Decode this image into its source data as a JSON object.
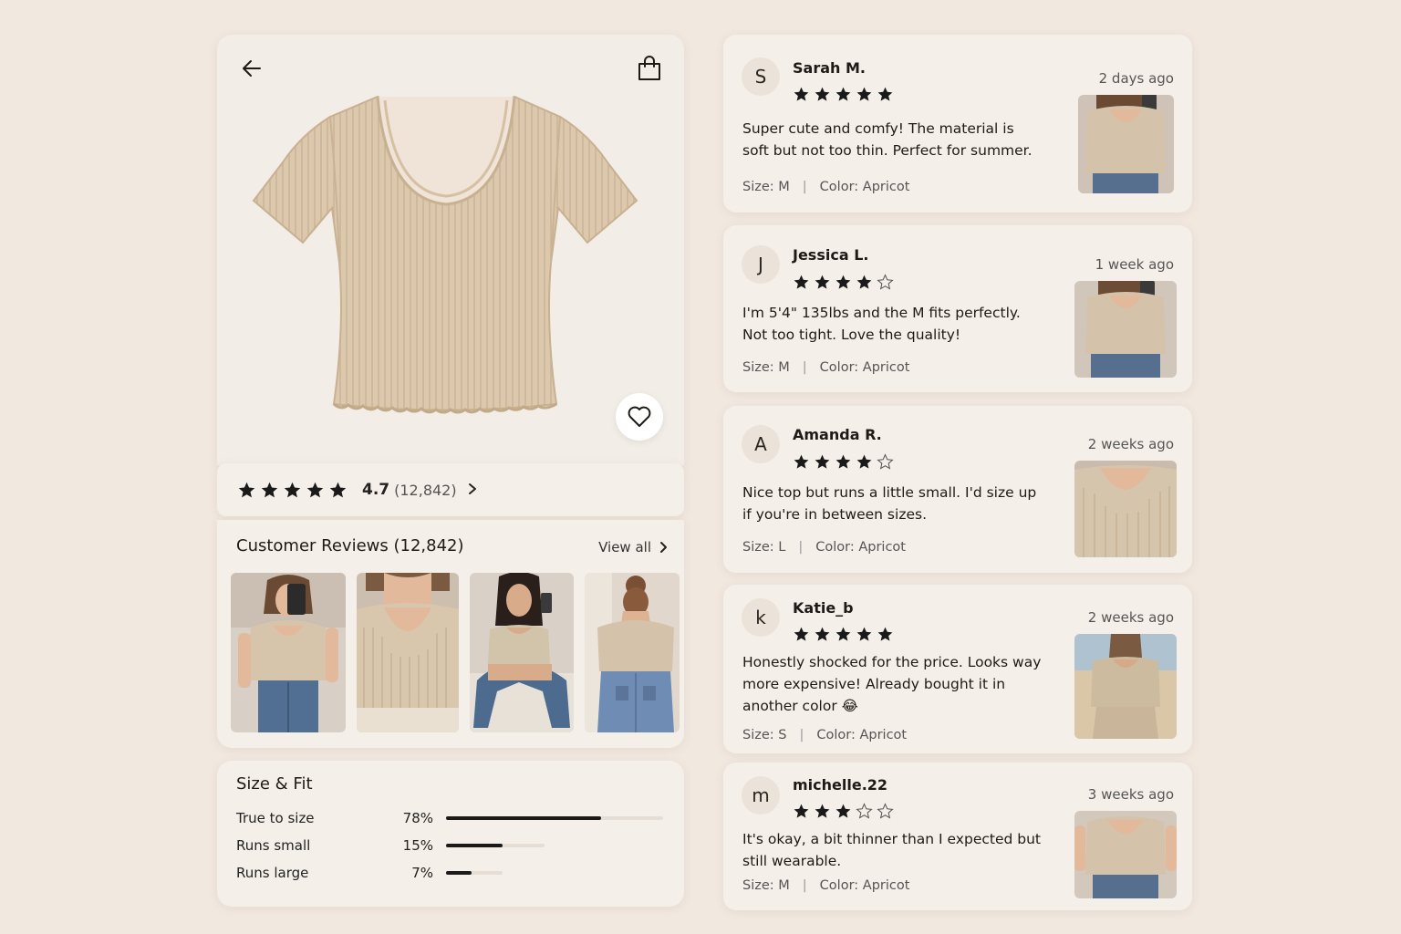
{
  "product": {
    "rating_value": "4.7",
    "rating_count": "(12,842)",
    "rating_stars": 5
  },
  "customer_reviews": {
    "title": "Customer Reviews (12,842)",
    "view_all": "View all"
  },
  "size_fit": {
    "title": "Size & Fit",
    "rows": [
      {
        "label": "True to size",
        "percent_text": "78%",
        "percent": 78
      },
      {
        "label": "Runs small",
        "percent_text": "15%",
        "percent": 15
      },
      {
        "label": "Runs large",
        "percent_text": "7%",
        "percent": 7
      }
    ]
  },
  "reviews": [
    {
      "initial": "S",
      "name": "Sarah M.",
      "stars": 5,
      "date": "2 days ago",
      "text": "Super cute and comfy! The material is soft but not too thin. Perfect for summer.",
      "size": "Size: M",
      "color": "Color: Apricot"
    },
    {
      "initial": "J",
      "name": "Jessica L.",
      "stars": 4,
      "date": "1 week ago",
      "text": "I'm 5'4\" 135lbs and the M fits perfectly. Not too tight. Love the quality!",
      "size": "Size: M",
      "color": "Color: Apricot"
    },
    {
      "initial": "A",
      "name": "Amanda R.",
      "stars": 4,
      "date": "2 weeks ago",
      "text": "Nice top but runs a little small. I'd size up if you're in between sizes.",
      "size": "Size: L",
      "color": "Color: Apricot"
    },
    {
      "initial": "k",
      "name": "Katie_b",
      "stars": 5,
      "date": "2 weeks ago",
      "text": "Honestly shocked for the price. Looks way more expensive! Already bought it in another color 😂",
      "size": "Size: S",
      "color": "Color: Apricot"
    },
    {
      "initial": "m",
      "name": "michelle.22",
      "stars": 3,
      "date": "3 weeks ago",
      "text": "It's okay, a bit thinner than I expected but still wearable.",
      "size": "Size: M",
      "color": "Color: Apricot"
    }
  ],
  "icons": {
    "back": "arrow-left-icon",
    "bag": "shopping-bag-icon",
    "favorite": "heart-icon",
    "star": "star-icon",
    "chevron": "chevron-right-icon"
  },
  "colors": {
    "background": "#f1e8e0",
    "card": "#f5efe9",
    "shirt": "#dcc8ad",
    "star": "#1a1a1a"
  }
}
